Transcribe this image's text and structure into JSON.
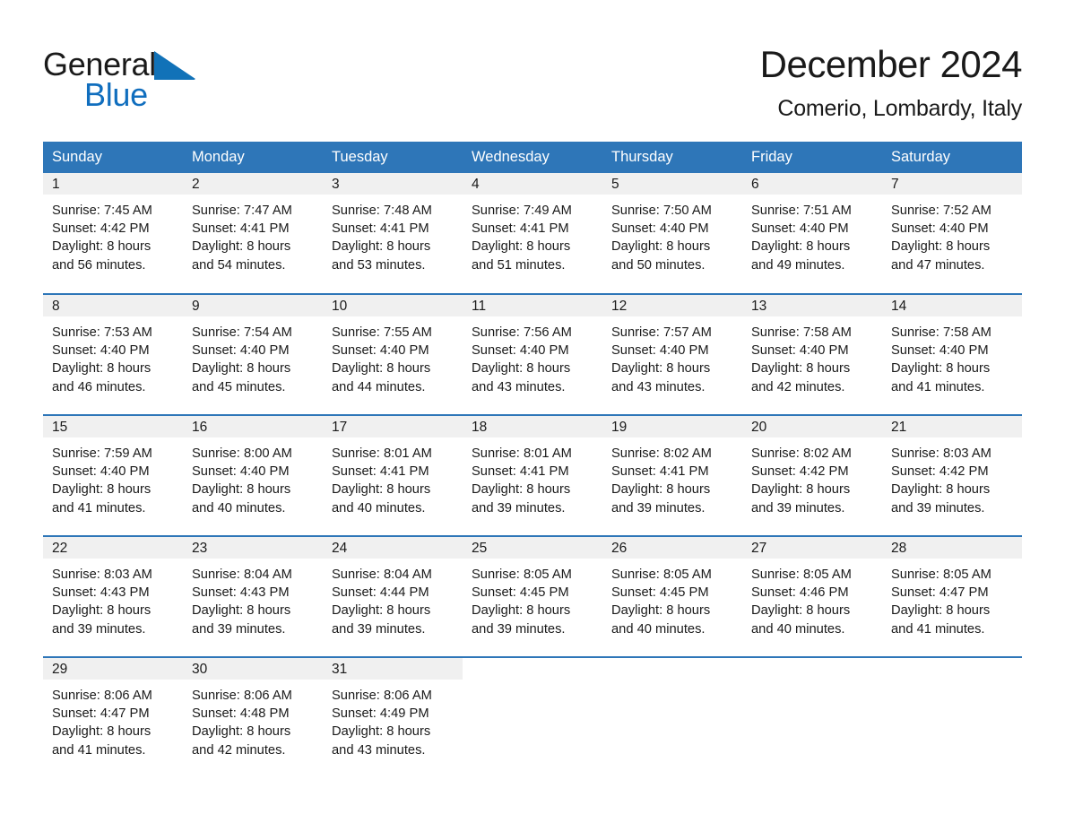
{
  "brand": {
    "name_part1": "General",
    "name_part2": "Blue",
    "logo_icon": "triangle-flag-icon",
    "accent_color": "#106ebe"
  },
  "header": {
    "title": "December 2024",
    "subtitle": "Comerio, Lombardy, Italy"
  },
  "theme": {
    "header_bg": "#2e76b8",
    "daynum_bg": "#f0f0f0",
    "text": "#1a1a1a"
  },
  "calendar": {
    "weekdays": [
      "Sunday",
      "Monday",
      "Tuesday",
      "Wednesday",
      "Thursday",
      "Friday",
      "Saturday"
    ],
    "weeks": [
      [
        {
          "day": "1",
          "sunrise": "Sunrise: 7:45 AM",
          "sunset": "Sunset: 4:42 PM",
          "daylight_line1": "Daylight: 8 hours",
          "daylight_line2": "and 56 minutes."
        },
        {
          "day": "2",
          "sunrise": "Sunrise: 7:47 AM",
          "sunset": "Sunset: 4:41 PM",
          "daylight_line1": "Daylight: 8 hours",
          "daylight_line2": "and 54 minutes."
        },
        {
          "day": "3",
          "sunrise": "Sunrise: 7:48 AM",
          "sunset": "Sunset: 4:41 PM",
          "daylight_line1": "Daylight: 8 hours",
          "daylight_line2": "and 53 minutes."
        },
        {
          "day": "4",
          "sunrise": "Sunrise: 7:49 AM",
          "sunset": "Sunset: 4:41 PM",
          "daylight_line1": "Daylight: 8 hours",
          "daylight_line2": "and 51 minutes."
        },
        {
          "day": "5",
          "sunrise": "Sunrise: 7:50 AM",
          "sunset": "Sunset: 4:40 PM",
          "daylight_line1": "Daylight: 8 hours",
          "daylight_line2": "and 50 minutes."
        },
        {
          "day": "6",
          "sunrise": "Sunrise: 7:51 AM",
          "sunset": "Sunset: 4:40 PM",
          "daylight_line1": "Daylight: 8 hours",
          "daylight_line2": "and 49 minutes."
        },
        {
          "day": "7",
          "sunrise": "Sunrise: 7:52 AM",
          "sunset": "Sunset: 4:40 PM",
          "daylight_line1": "Daylight: 8 hours",
          "daylight_line2": "and 47 minutes."
        }
      ],
      [
        {
          "day": "8",
          "sunrise": "Sunrise: 7:53 AM",
          "sunset": "Sunset: 4:40 PM",
          "daylight_line1": "Daylight: 8 hours",
          "daylight_line2": "and 46 minutes."
        },
        {
          "day": "9",
          "sunrise": "Sunrise: 7:54 AM",
          "sunset": "Sunset: 4:40 PM",
          "daylight_line1": "Daylight: 8 hours",
          "daylight_line2": "and 45 minutes."
        },
        {
          "day": "10",
          "sunrise": "Sunrise: 7:55 AM",
          "sunset": "Sunset: 4:40 PM",
          "daylight_line1": "Daylight: 8 hours",
          "daylight_line2": "and 44 minutes."
        },
        {
          "day": "11",
          "sunrise": "Sunrise: 7:56 AM",
          "sunset": "Sunset: 4:40 PM",
          "daylight_line1": "Daylight: 8 hours",
          "daylight_line2": "and 43 minutes."
        },
        {
          "day": "12",
          "sunrise": "Sunrise: 7:57 AM",
          "sunset": "Sunset: 4:40 PM",
          "daylight_line1": "Daylight: 8 hours",
          "daylight_line2": "and 43 minutes."
        },
        {
          "day": "13",
          "sunrise": "Sunrise: 7:58 AM",
          "sunset": "Sunset: 4:40 PM",
          "daylight_line1": "Daylight: 8 hours",
          "daylight_line2": "and 42 minutes."
        },
        {
          "day": "14",
          "sunrise": "Sunrise: 7:58 AM",
          "sunset": "Sunset: 4:40 PM",
          "daylight_line1": "Daylight: 8 hours",
          "daylight_line2": "and 41 minutes."
        }
      ],
      [
        {
          "day": "15",
          "sunrise": "Sunrise: 7:59 AM",
          "sunset": "Sunset: 4:40 PM",
          "daylight_line1": "Daylight: 8 hours",
          "daylight_line2": "and 41 minutes."
        },
        {
          "day": "16",
          "sunrise": "Sunrise: 8:00 AM",
          "sunset": "Sunset: 4:40 PM",
          "daylight_line1": "Daylight: 8 hours",
          "daylight_line2": "and 40 minutes."
        },
        {
          "day": "17",
          "sunrise": "Sunrise: 8:01 AM",
          "sunset": "Sunset: 4:41 PM",
          "daylight_line1": "Daylight: 8 hours",
          "daylight_line2": "and 40 minutes."
        },
        {
          "day": "18",
          "sunrise": "Sunrise: 8:01 AM",
          "sunset": "Sunset: 4:41 PM",
          "daylight_line1": "Daylight: 8 hours",
          "daylight_line2": "and 39 minutes."
        },
        {
          "day": "19",
          "sunrise": "Sunrise: 8:02 AM",
          "sunset": "Sunset: 4:41 PM",
          "daylight_line1": "Daylight: 8 hours",
          "daylight_line2": "and 39 minutes."
        },
        {
          "day": "20",
          "sunrise": "Sunrise: 8:02 AM",
          "sunset": "Sunset: 4:42 PM",
          "daylight_line1": "Daylight: 8 hours",
          "daylight_line2": "and 39 minutes."
        },
        {
          "day": "21",
          "sunrise": "Sunrise: 8:03 AM",
          "sunset": "Sunset: 4:42 PM",
          "daylight_line1": "Daylight: 8 hours",
          "daylight_line2": "and 39 minutes."
        }
      ],
      [
        {
          "day": "22",
          "sunrise": "Sunrise: 8:03 AM",
          "sunset": "Sunset: 4:43 PM",
          "daylight_line1": "Daylight: 8 hours",
          "daylight_line2": "and 39 minutes."
        },
        {
          "day": "23",
          "sunrise": "Sunrise: 8:04 AM",
          "sunset": "Sunset: 4:43 PM",
          "daylight_line1": "Daylight: 8 hours",
          "daylight_line2": "and 39 minutes."
        },
        {
          "day": "24",
          "sunrise": "Sunrise: 8:04 AM",
          "sunset": "Sunset: 4:44 PM",
          "daylight_line1": "Daylight: 8 hours",
          "daylight_line2": "and 39 minutes."
        },
        {
          "day": "25",
          "sunrise": "Sunrise: 8:05 AM",
          "sunset": "Sunset: 4:45 PM",
          "daylight_line1": "Daylight: 8 hours",
          "daylight_line2": "and 39 minutes."
        },
        {
          "day": "26",
          "sunrise": "Sunrise: 8:05 AM",
          "sunset": "Sunset: 4:45 PM",
          "daylight_line1": "Daylight: 8 hours",
          "daylight_line2": "and 40 minutes."
        },
        {
          "day": "27",
          "sunrise": "Sunrise: 8:05 AM",
          "sunset": "Sunset: 4:46 PM",
          "daylight_line1": "Daylight: 8 hours",
          "daylight_line2": "and 40 minutes."
        },
        {
          "day": "28",
          "sunrise": "Sunrise: 8:05 AM",
          "sunset": "Sunset: 4:47 PM",
          "daylight_line1": "Daylight: 8 hours",
          "daylight_line2": "and 41 minutes."
        }
      ],
      [
        {
          "day": "29",
          "sunrise": "Sunrise: 8:06 AM",
          "sunset": "Sunset: 4:47 PM",
          "daylight_line1": "Daylight: 8 hours",
          "daylight_line2": "and 41 minutes."
        },
        {
          "day": "30",
          "sunrise": "Sunrise: 8:06 AM",
          "sunset": "Sunset: 4:48 PM",
          "daylight_line1": "Daylight: 8 hours",
          "daylight_line2": "and 42 minutes."
        },
        {
          "day": "31",
          "sunrise": "Sunrise: 8:06 AM",
          "sunset": "Sunset: 4:49 PM",
          "daylight_line1": "Daylight: 8 hours",
          "daylight_line2": "and 43 minutes."
        },
        {
          "day": "",
          "sunrise": "",
          "sunset": "",
          "daylight_line1": "",
          "daylight_line2": ""
        },
        {
          "day": "",
          "sunrise": "",
          "sunset": "",
          "daylight_line1": "",
          "daylight_line2": ""
        },
        {
          "day": "",
          "sunrise": "",
          "sunset": "",
          "daylight_line1": "",
          "daylight_line2": ""
        },
        {
          "day": "",
          "sunrise": "",
          "sunset": "",
          "daylight_line1": "",
          "daylight_line2": ""
        }
      ]
    ]
  }
}
